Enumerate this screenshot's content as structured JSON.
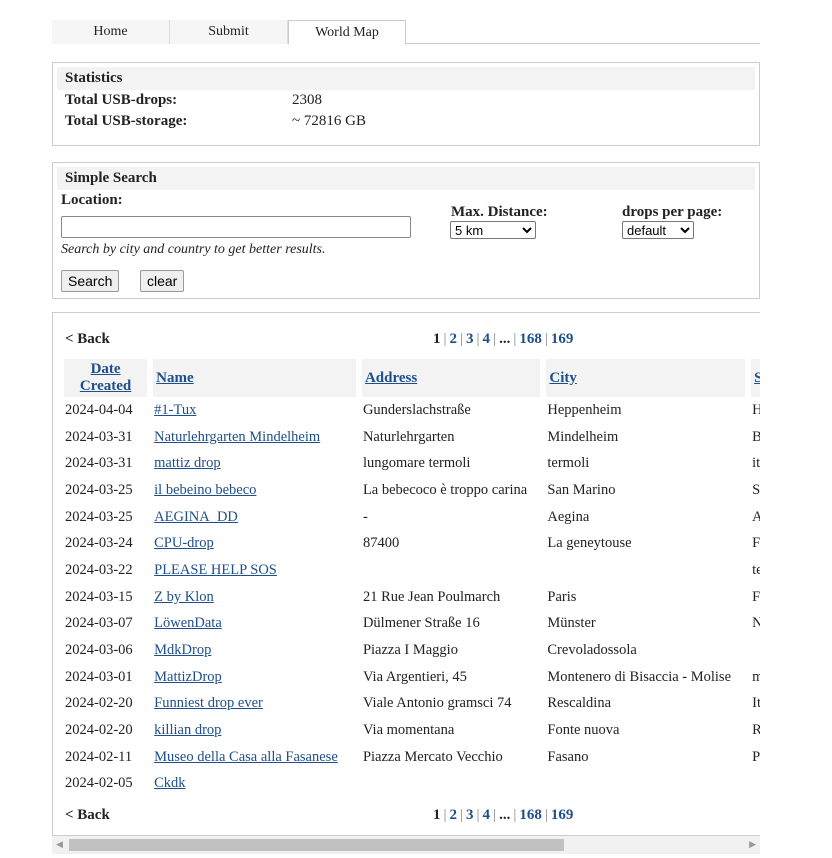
{
  "tabs": [
    {
      "label": "Home"
    },
    {
      "label": "Submit"
    },
    {
      "label": "World Map"
    }
  ],
  "stats": {
    "title": "Statistics",
    "drops_label": "Total USB-drops:",
    "drops_value": "2308",
    "storage_label": "Total USB-storage:",
    "storage_value": "~ 72816 GB"
  },
  "search": {
    "title": "Simple Search",
    "location_label": "Location:",
    "location_value": "",
    "hint": "Search by city and country to get better results.",
    "distance_label": "Max. Distance:",
    "distance_value": "5 km",
    "per_page_label": "drops per page:",
    "per_page_value": "default",
    "search_button": "Search",
    "clear_button": "clear"
  },
  "pager": {
    "back": "< Back",
    "current": "1",
    "pages": [
      "2",
      "3",
      "4",
      "...",
      "168",
      "169"
    ]
  },
  "table": {
    "headers": [
      "Date Created",
      "Name",
      "Address",
      "City",
      "St"
    ],
    "rows": [
      [
        "2024-04-04",
        "#1-Tux",
        "Gunderslachstraße",
        "Heppenheim",
        "He"
      ],
      [
        "2024-03-31",
        "Naturlehrgarten Mindelheim",
        "Naturlehrgarten",
        "Mindelheim",
        "Ba"
      ],
      [
        "2024-03-31",
        "mattiz drop",
        "lungomare termoli",
        "termoli",
        "ital"
      ],
      [
        "2024-03-25",
        "il bebeino bebeco",
        "La bebecoco è troppo carina",
        "San Marino",
        "Sa"
      ],
      [
        "2024-03-25",
        "AEGINA_DD",
        "-",
        "Aegina",
        "Att"
      ],
      [
        "2024-03-24",
        "CPU-drop",
        "87400",
        "La geneytouse",
        "Fra"
      ],
      [
        "2024-03-22",
        "PLEASE HELP SOS",
        "",
        "",
        "tex"
      ],
      [
        "2024-03-15",
        "Z by Klon",
        "21 Rue Jean Poulmarch",
        "Paris",
        "Fra"
      ],
      [
        "2024-03-07",
        "LöwenData",
        "Dülmener Straße 16",
        "Münster",
        "NR"
      ],
      [
        "2024-03-06",
        "MdkDrop",
        "Piazza I Maggio",
        "Crevoladossola",
        ""
      ],
      [
        "2024-03-01",
        "MattizDrop",
        "Via Argentieri, 45",
        "Montenero di Bisaccia - Molise",
        "mo"
      ],
      [
        "2024-02-20",
        "Funniest drop ever",
        "Viale Antonio gramsci 74",
        "Rescaldina",
        "Ita"
      ],
      [
        "2024-02-20",
        "killian drop",
        "Via momentana",
        "Fonte nuova",
        "RC"
      ],
      [
        "2024-02-11",
        "Museo della Casa alla Fasanese",
        "Piazza Mercato Vecchio",
        "Fasano",
        "Pu"
      ],
      [
        "2024-02-05",
        "Ckdk",
        "",
        "",
        ""
      ]
    ]
  },
  "colors": {
    "link": "#1e4e8c",
    "header_bg": "#f3f3f3"
  }
}
